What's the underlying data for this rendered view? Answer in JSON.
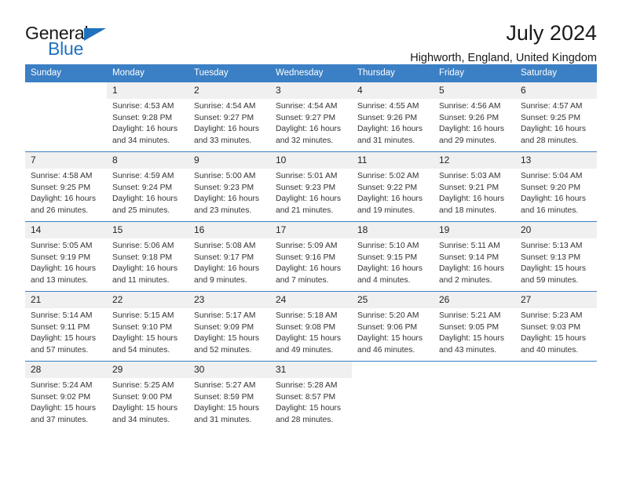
{
  "brand": {
    "name_part1": "General",
    "name_part2": "Blue",
    "accent_color": "#1f72bd"
  },
  "header": {
    "title": "July 2024",
    "subtitle": "Highworth, England, United Kingdom"
  },
  "calendar": {
    "header_bg": "#3b7fc4",
    "daynum_bg": "#f0f0f0",
    "weekday_headers": [
      "Sunday",
      "Monday",
      "Tuesday",
      "Wednesday",
      "Thursday",
      "Friday",
      "Saturday"
    ],
    "labels": {
      "sunrise": "Sunrise:",
      "sunset": "Sunset:",
      "daylight": "Daylight:"
    },
    "weeks": [
      [
        {
          "day": "",
          "sunrise": "",
          "sunset": "",
          "daylight_line1": "",
          "daylight_line2": ""
        },
        {
          "day": "1",
          "sunrise": "Sunrise: 4:53 AM",
          "sunset": "Sunset: 9:28 PM",
          "daylight_line1": "Daylight: 16 hours",
          "daylight_line2": "and 34 minutes."
        },
        {
          "day": "2",
          "sunrise": "Sunrise: 4:54 AM",
          "sunset": "Sunset: 9:27 PM",
          "daylight_line1": "Daylight: 16 hours",
          "daylight_line2": "and 33 minutes."
        },
        {
          "day": "3",
          "sunrise": "Sunrise: 4:54 AM",
          "sunset": "Sunset: 9:27 PM",
          "daylight_line1": "Daylight: 16 hours",
          "daylight_line2": "and 32 minutes."
        },
        {
          "day": "4",
          "sunrise": "Sunrise: 4:55 AM",
          "sunset": "Sunset: 9:26 PM",
          "daylight_line1": "Daylight: 16 hours",
          "daylight_line2": "and 31 minutes."
        },
        {
          "day": "5",
          "sunrise": "Sunrise: 4:56 AM",
          "sunset": "Sunset: 9:26 PM",
          "daylight_line1": "Daylight: 16 hours",
          "daylight_line2": "and 29 minutes."
        },
        {
          "day": "6",
          "sunrise": "Sunrise: 4:57 AM",
          "sunset": "Sunset: 9:25 PM",
          "daylight_line1": "Daylight: 16 hours",
          "daylight_line2": "and 28 minutes."
        }
      ],
      [
        {
          "day": "7",
          "sunrise": "Sunrise: 4:58 AM",
          "sunset": "Sunset: 9:25 PM",
          "daylight_line1": "Daylight: 16 hours",
          "daylight_line2": "and 26 minutes."
        },
        {
          "day": "8",
          "sunrise": "Sunrise: 4:59 AM",
          "sunset": "Sunset: 9:24 PM",
          "daylight_line1": "Daylight: 16 hours",
          "daylight_line2": "and 25 minutes."
        },
        {
          "day": "9",
          "sunrise": "Sunrise: 5:00 AM",
          "sunset": "Sunset: 9:23 PM",
          "daylight_line1": "Daylight: 16 hours",
          "daylight_line2": "and 23 minutes."
        },
        {
          "day": "10",
          "sunrise": "Sunrise: 5:01 AM",
          "sunset": "Sunset: 9:23 PM",
          "daylight_line1": "Daylight: 16 hours",
          "daylight_line2": "and 21 minutes."
        },
        {
          "day": "11",
          "sunrise": "Sunrise: 5:02 AM",
          "sunset": "Sunset: 9:22 PM",
          "daylight_line1": "Daylight: 16 hours",
          "daylight_line2": "and 19 minutes."
        },
        {
          "day": "12",
          "sunrise": "Sunrise: 5:03 AM",
          "sunset": "Sunset: 9:21 PM",
          "daylight_line1": "Daylight: 16 hours",
          "daylight_line2": "and 18 minutes."
        },
        {
          "day": "13",
          "sunrise": "Sunrise: 5:04 AM",
          "sunset": "Sunset: 9:20 PM",
          "daylight_line1": "Daylight: 16 hours",
          "daylight_line2": "and 16 minutes."
        }
      ],
      [
        {
          "day": "14",
          "sunrise": "Sunrise: 5:05 AM",
          "sunset": "Sunset: 9:19 PM",
          "daylight_line1": "Daylight: 16 hours",
          "daylight_line2": "and 13 minutes."
        },
        {
          "day": "15",
          "sunrise": "Sunrise: 5:06 AM",
          "sunset": "Sunset: 9:18 PM",
          "daylight_line1": "Daylight: 16 hours",
          "daylight_line2": "and 11 minutes."
        },
        {
          "day": "16",
          "sunrise": "Sunrise: 5:08 AM",
          "sunset": "Sunset: 9:17 PM",
          "daylight_line1": "Daylight: 16 hours",
          "daylight_line2": "and 9 minutes."
        },
        {
          "day": "17",
          "sunrise": "Sunrise: 5:09 AM",
          "sunset": "Sunset: 9:16 PM",
          "daylight_line1": "Daylight: 16 hours",
          "daylight_line2": "and 7 minutes."
        },
        {
          "day": "18",
          "sunrise": "Sunrise: 5:10 AM",
          "sunset": "Sunset: 9:15 PM",
          "daylight_line1": "Daylight: 16 hours",
          "daylight_line2": "and 4 minutes."
        },
        {
          "day": "19",
          "sunrise": "Sunrise: 5:11 AM",
          "sunset": "Sunset: 9:14 PM",
          "daylight_line1": "Daylight: 16 hours",
          "daylight_line2": "and 2 minutes."
        },
        {
          "day": "20",
          "sunrise": "Sunrise: 5:13 AM",
          "sunset": "Sunset: 9:13 PM",
          "daylight_line1": "Daylight: 15 hours",
          "daylight_line2": "and 59 minutes."
        }
      ],
      [
        {
          "day": "21",
          "sunrise": "Sunrise: 5:14 AM",
          "sunset": "Sunset: 9:11 PM",
          "daylight_line1": "Daylight: 15 hours",
          "daylight_line2": "and 57 minutes."
        },
        {
          "day": "22",
          "sunrise": "Sunrise: 5:15 AM",
          "sunset": "Sunset: 9:10 PM",
          "daylight_line1": "Daylight: 15 hours",
          "daylight_line2": "and 54 minutes."
        },
        {
          "day": "23",
          "sunrise": "Sunrise: 5:17 AM",
          "sunset": "Sunset: 9:09 PM",
          "daylight_line1": "Daylight: 15 hours",
          "daylight_line2": "and 52 minutes."
        },
        {
          "day": "24",
          "sunrise": "Sunrise: 5:18 AM",
          "sunset": "Sunset: 9:08 PM",
          "daylight_line1": "Daylight: 15 hours",
          "daylight_line2": "and 49 minutes."
        },
        {
          "day": "25",
          "sunrise": "Sunrise: 5:20 AM",
          "sunset": "Sunset: 9:06 PM",
          "daylight_line1": "Daylight: 15 hours",
          "daylight_line2": "and 46 minutes."
        },
        {
          "day": "26",
          "sunrise": "Sunrise: 5:21 AM",
          "sunset": "Sunset: 9:05 PM",
          "daylight_line1": "Daylight: 15 hours",
          "daylight_line2": "and 43 minutes."
        },
        {
          "day": "27",
          "sunrise": "Sunrise: 5:23 AM",
          "sunset": "Sunset: 9:03 PM",
          "daylight_line1": "Daylight: 15 hours",
          "daylight_line2": "and 40 minutes."
        }
      ],
      [
        {
          "day": "28",
          "sunrise": "Sunrise: 5:24 AM",
          "sunset": "Sunset: 9:02 PM",
          "daylight_line1": "Daylight: 15 hours",
          "daylight_line2": "and 37 minutes."
        },
        {
          "day": "29",
          "sunrise": "Sunrise: 5:25 AM",
          "sunset": "Sunset: 9:00 PM",
          "daylight_line1": "Daylight: 15 hours",
          "daylight_line2": "and 34 minutes."
        },
        {
          "day": "30",
          "sunrise": "Sunrise: 5:27 AM",
          "sunset": "Sunset: 8:59 PM",
          "daylight_line1": "Daylight: 15 hours",
          "daylight_line2": "and 31 minutes."
        },
        {
          "day": "31",
          "sunrise": "Sunrise: 5:28 AM",
          "sunset": "Sunset: 8:57 PM",
          "daylight_line1": "Daylight: 15 hours",
          "daylight_line2": "and 28 minutes."
        },
        {
          "day": "",
          "sunrise": "",
          "sunset": "",
          "daylight_line1": "",
          "daylight_line2": ""
        },
        {
          "day": "",
          "sunrise": "",
          "sunset": "",
          "daylight_line1": "",
          "daylight_line2": ""
        },
        {
          "day": "",
          "sunrise": "",
          "sunset": "",
          "daylight_line1": "",
          "daylight_line2": ""
        }
      ]
    ]
  }
}
